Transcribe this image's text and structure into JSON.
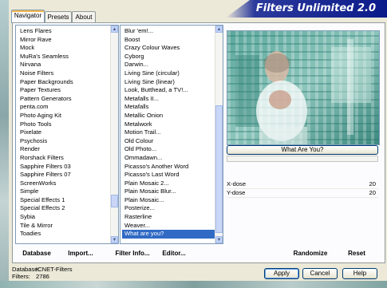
{
  "window": {
    "title": "Filters Unlimited 2.0"
  },
  "tabs": [
    {
      "label": "Navigator",
      "active": true
    },
    {
      "label": "Presets",
      "active": false
    },
    {
      "label": "About",
      "active": false
    }
  ],
  "categories": {
    "items": [
      "Lens Flares",
      "Mirror Rave",
      "Mock",
      "MuRa's Seamless",
      "Nirvana",
      "Noise Filters",
      "Paper Backgrounds",
      "Paper Textures",
      "Pattern Generators",
      "penta.com",
      "Photo Aging Kit",
      "Photo Tools",
      "Pixelate",
      "Psychosis",
      "Render",
      "Rorshack Filters",
      "Sapphire Filters 03",
      "Sapphire Filters 07",
      "ScreenWorks",
      "Simple",
      "Special Effects 1",
      "Special Effects 2",
      "Sybia",
      "Tile & Mirror",
      "Toadies"
    ]
  },
  "filters": {
    "items": [
      "Blur 'em!...",
      "Boost",
      "Crazy Colour Waves",
      "Cyborg",
      "Darwin...",
      "Living Sine (circular)",
      "Living Sine (linear)",
      "Look, Butthead, a TV!...",
      "Metafalls II...",
      "Metafalls",
      "Metallic Onion",
      "Metalwork",
      "Motion Trail...",
      "Old Colour",
      "Old Photo...",
      "Ommadawn...",
      "Picasso's Another Word",
      "Picasso's Last Word",
      "Plain Mosaic 2...",
      "Plain Mosaic Blur...",
      "Plain Mosaic...",
      "Posterize...",
      "Rasterline",
      "Weaver...",
      "What are you?"
    ],
    "selected": "What are you?"
  },
  "preview": {
    "filter_title": "What Are You?"
  },
  "params": [
    {
      "label": "X-dose",
      "value": "20"
    },
    {
      "label": "Y-dose",
      "value": "20"
    }
  ],
  "toolbar": {
    "database": "Database",
    "import": "Import...",
    "filter_info": "Filter Info...",
    "editor": "Editor...",
    "randomize": "Randomize",
    "reset": "Reset"
  },
  "status": {
    "database_label": "Database:",
    "database_value": "ICNET-Filters",
    "filters_label": "Filters:",
    "filters_value": "2786"
  },
  "buttons": {
    "apply": "Apply",
    "cancel": "Cancel",
    "help": "Help"
  },
  "colors": {
    "selection": "#316ac5",
    "banner": "#0b1a8a",
    "preview_teal": "#4f9d93"
  }
}
